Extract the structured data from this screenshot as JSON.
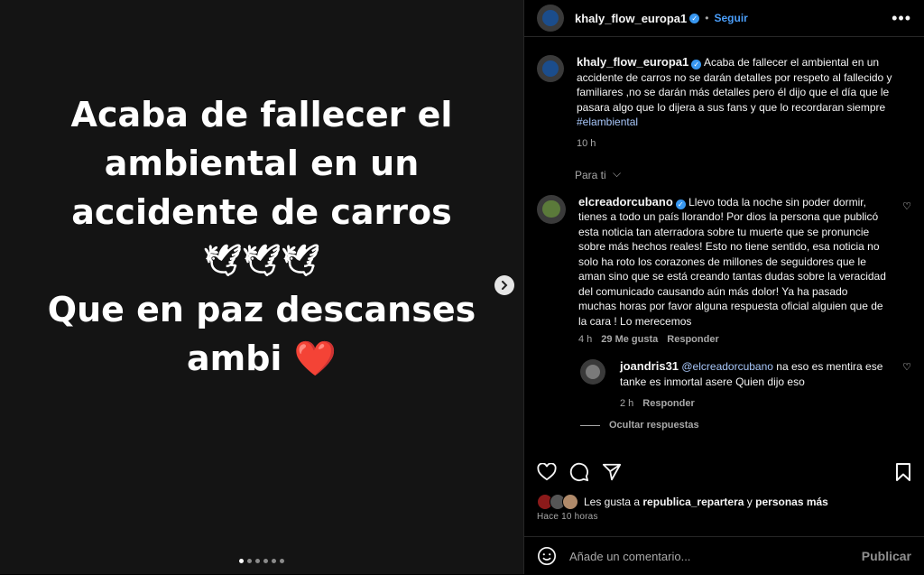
{
  "story": {
    "lines": [
      "Acaba de fallecer el",
      "ambiental en un",
      "accidente de carros"
    ],
    "doves": "🕊🕊🕊",
    "line4": "Que en paz descanses",
    "line5": "ambi",
    "heart": "❤️"
  },
  "carousel": {
    "total_dots": 6,
    "active_index": 0
  },
  "header": {
    "username": "khaly_flow_europa1",
    "follow_label": "Seguir",
    "more_label": "•••"
  },
  "caption": {
    "username": "khaly_flow_europa1",
    "text": "Acaba de fallecer el ambiental en un accidente de carros no se darán detalles por respeto al fallecido y familiares ,no se darán más detalles pero él dijo que el día que le pasara algo que lo dijera a sus fans y que lo recordaran siempre",
    "hashtag": "#elambiental",
    "time": "10 h"
  },
  "filter": {
    "label": "Para ti",
    "chevron": "⌵"
  },
  "comments": [
    {
      "username": "elcreadorcubano",
      "text": "Llevo toda la noche sin poder dormir, tienes a todo un país llorando! Por dios la persona que publicó esta noticia tan aterradora sobre tu muerte que se pronuncie sobre más hechos reales! Esto no tiene sentido, esa noticia no solo ha roto los corazones de millones de seguidores que le aman sino que se está creando tantas dudas sobre la veracidad del comunicado causando aún más dolor! Ya ha pasado muchas horas por favor alguna respuesta oficial alguien que de la cara ! Lo merecemos",
      "time": "4 h",
      "likes": "29 Me gusta",
      "reply": "Responder"
    }
  ],
  "reply": {
    "username": "joandris31",
    "mention": "@elcreadorcubano",
    "text": "na eso es mentira ese tanke es inmortal asere Quien dijo eso",
    "time": "2 h",
    "reply": "Responder"
  },
  "hide_replies": "Ocultar respuestas",
  "likes": {
    "prefix": "Les gusta a",
    "user": "republica_repartera",
    "conj": "y",
    "others": "personas más"
  },
  "posted_ago": "Hace 10 horas",
  "composer": {
    "placeholder": "Añade un comentario...",
    "publish": "Publicar"
  },
  "colors": {
    "link": "#4a9df8",
    "hashtag": "#a8c7fa",
    "heart": "#e0242f"
  }
}
